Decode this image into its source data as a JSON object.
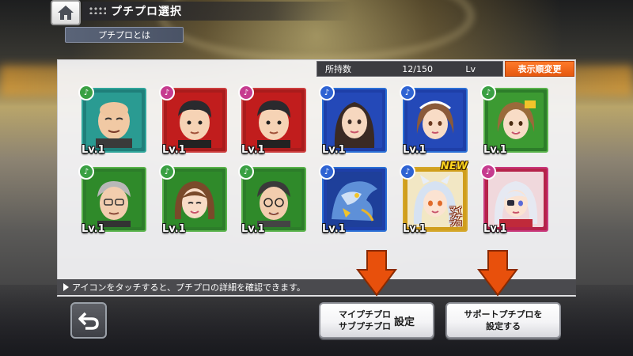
{
  "header": {
    "title": "プチプロ選択",
    "about_button": "プチプロとは"
  },
  "panel": {
    "owned_label": "所持数",
    "owned_count": "12/150",
    "sort_field": "Lv",
    "sort_button": "表示順変更",
    "hint": "アイコンをタッチすると、プチプロの詳細を確認できます。"
  },
  "cards": [
    {
      "level": "Lv.1",
      "frame": "teal",
      "attribute": "green",
      "character": "bald man"
    },
    {
      "level": "Lv.1",
      "frame": "red",
      "attribute": "pink",
      "character": "dark haired man"
    },
    {
      "level": "Lv.1",
      "frame": "red",
      "attribute": "pink",
      "character": "dark haired man"
    },
    {
      "level": "Lv.1",
      "frame": "blue",
      "attribute": "blue",
      "character": "long haired woman"
    },
    {
      "level": "Lv.1",
      "frame": "blue",
      "attribute": "blue",
      "character": "girl with headband"
    },
    {
      "level": "Lv.1",
      "frame": "green",
      "attribute": "green",
      "character": "brown haired girl"
    },
    {
      "level": "Lv.1",
      "frame": "green",
      "attribute": "green",
      "character": "grey haired man with glasses"
    },
    {
      "level": "Lv.1",
      "frame": "green",
      "attribute": "green",
      "character": "bob haired woman"
    },
    {
      "level": "Lv.1",
      "frame": "green",
      "attribute": "green",
      "character": "man with glasses"
    },
    {
      "level": "Lv.1",
      "frame": "blue",
      "attribute": "blue",
      "character": "blue dragon"
    },
    {
      "level": "Lv.1",
      "frame": "gold",
      "attribute": "blue",
      "character": "white haired anime girl",
      "badge": "NEW",
      "tag": "マイ プチプロ"
    },
    {
      "level": "Lv.1",
      "frame": "magenta",
      "attribute": "pink",
      "character": "anime girl with eyepatch"
    }
  ],
  "buttons": {
    "my_line1": "マイプチプロ",
    "my_line2": "サブプチプロ",
    "my_side": "設定",
    "support_line1": "サポートプチプロを",
    "support_line2": "設定する"
  },
  "colors": {
    "sort_button": "#e5580f",
    "arrow": "#e8500c",
    "new_badge": "#ffd61f"
  }
}
